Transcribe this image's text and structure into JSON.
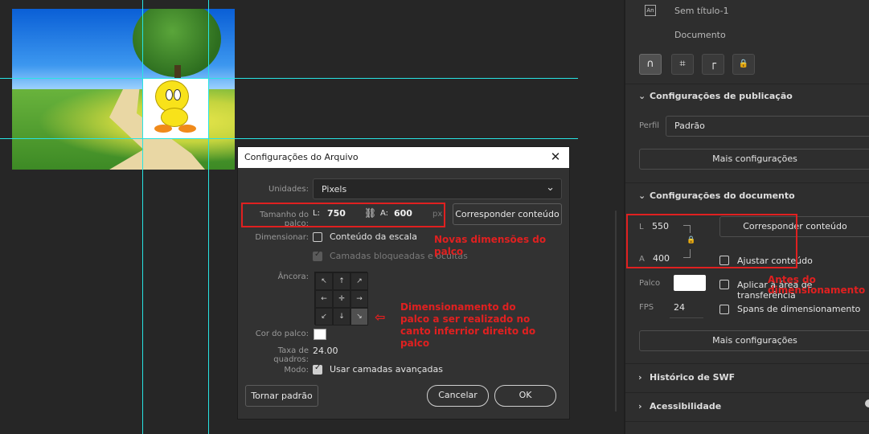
{
  "dialog": {
    "title": "Configurações do Arquivo",
    "units_label": "Unidades:",
    "units_value": "Pixels",
    "stage_size_label": "Tamanho do palco:",
    "width_prefix": "L:",
    "width_value": "750",
    "height_prefix": "A:",
    "height_value": "600",
    "unit_suffix": "px",
    "match_contents_button": "Corresponder conteúdo",
    "scale_label": "Dimensionar:",
    "scale_content_label": "Conteúdo da escala",
    "locked_layers_label": "Camadas bloqueadas e ocultas",
    "anchor_label": "Âncora:",
    "anchor_glyphs": [
      "↖",
      "↑",
      "↗",
      "←",
      "✛",
      "→",
      "↙",
      "↓",
      "↘"
    ],
    "stage_color_label": "Cor do palco:",
    "stage_color": "#ffffff",
    "frame_rate_label": "Taxa de quadros:",
    "frame_rate_value": "24.00",
    "mode_label": "Modo:",
    "advanced_layers_label": "Usar camadas avançadas",
    "make_default_button": "Tornar padrão",
    "cancel_button": "Cancelar",
    "ok_button": "OK",
    "close_glyph": "✕"
  },
  "annotations": {
    "new_dimensions": "Novas dimensões do palco",
    "resize_note": "Dimensionamento do palco a ser realizado no canto inferrior direito do palco",
    "before_resize": "Antes do dimensionamento",
    "arrow_glyph": "⇦",
    "accent_color": "#e02020"
  },
  "panel": {
    "document_icon": "An",
    "document_name": "Sem título-1",
    "document_type": "Documento",
    "tool_icons": [
      "magnet-icon",
      "transform-icon",
      "ruler-icon",
      "lock-icon"
    ],
    "tool_glyphs": [
      "∩",
      "⌗",
      "┌",
      "🔒"
    ],
    "publish_section": "Configurações de publicação",
    "profile_label": "Perfil",
    "profile_value": "Padrão",
    "more_settings_1": "Mais configurações",
    "document_section": "Configurações do documento",
    "width_prefix": "L",
    "width_value": "550",
    "height_prefix": "A",
    "height_value": "400",
    "match_contents_button": "Corresponder conteúdo",
    "fit_contents_label": "Ajustar conteúdo",
    "stage_label": "Palco",
    "stage_color": "#ffffff",
    "apply_clipboard_label": "Aplicar à área de transferência",
    "fps_label": "FPS",
    "fps_value": "24",
    "scaling_spans_label": "Spans de dimensionamento",
    "more_settings_2": "Mais configurações",
    "swf_history_section": "Histórico de SWF",
    "accessibility_section": "Acessibilidade",
    "collapsed_glyph": "›",
    "expanded_glyph": "⌄"
  },
  "colors": {
    "guide": "#27e3e3",
    "background": "#262626",
    "panel": "#2e2e2e"
  }
}
